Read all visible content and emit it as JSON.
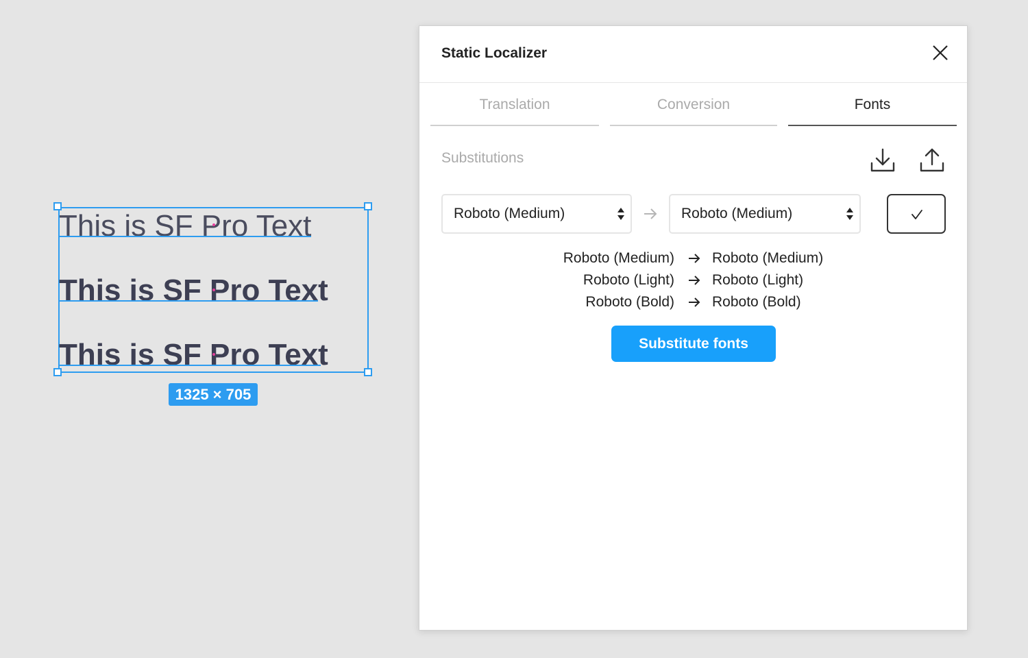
{
  "canvas": {
    "sample_texts": [
      "This is SF Pro Text",
      "This is SF Pro Text",
      "This is SF Pro Text"
    ],
    "dimension_label": "1325 × 705",
    "selection_color": "#2d9cf0"
  },
  "panel": {
    "title": "Static Localizer",
    "close_icon": "close-icon",
    "tabs": [
      {
        "label": "Translation",
        "active": false
      },
      {
        "label": "Conversion",
        "active": false
      },
      {
        "label": "Fonts",
        "active": true
      }
    ],
    "section_label": "Substitutions",
    "download_icon": "download-icon",
    "upload_icon": "upload-icon",
    "from_select": {
      "value": "Roboto (Medium)"
    },
    "to_select": {
      "value": "Roboto (Medium)"
    },
    "confirm_icon": "check-icon",
    "substitutions": [
      {
        "from": "Roboto (Medium)",
        "to": "Roboto (Medium)"
      },
      {
        "from": "Roboto (Light)",
        "to": "Roboto (Light)"
      },
      {
        "from": "Roboto (Bold)",
        "to": "Roboto (Bold)"
      }
    ],
    "primary_button": "Substitute fonts",
    "accent_color": "#18a0fb"
  }
}
